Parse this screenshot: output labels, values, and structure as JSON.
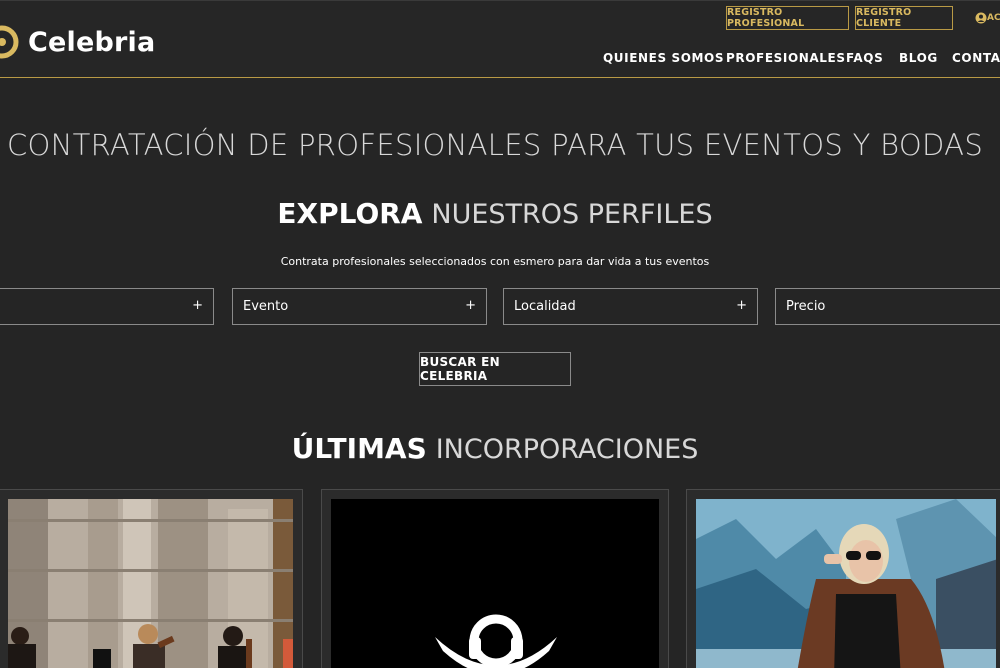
{
  "header": {
    "brand": "Celebria",
    "registro_profesional": "REGISTRO PROFESIONAL",
    "registro_cliente": "REGISTRO CLIENTE",
    "account_label": "AC",
    "nav": [
      "QUIENES SOMOS",
      "PROFESIONALES",
      "FAQS",
      "BLOG",
      "CONTACTO"
    ],
    "accent": "#b99a45"
  },
  "hero": {
    "title": "CONTRATACIÓN DE PROFESIONALES PARA TUS EVENTOS Y BODAS",
    "explora_bold": "EXPLORA",
    "explora_light": "NUESTROS PERFILES",
    "subtitle": "Contrata profesionales seleccionados con esmero para dar vida a tus eventos"
  },
  "filters": {
    "f0": "",
    "f1": "Evento",
    "f2": "Localidad",
    "f3": "Precio",
    "plus": "+"
  },
  "search_button": "BUSCAR EN CELEBRIA",
  "ultimas": {
    "bold": "ÚLTIMAS",
    "light": "INCORPORACIONES"
  }
}
